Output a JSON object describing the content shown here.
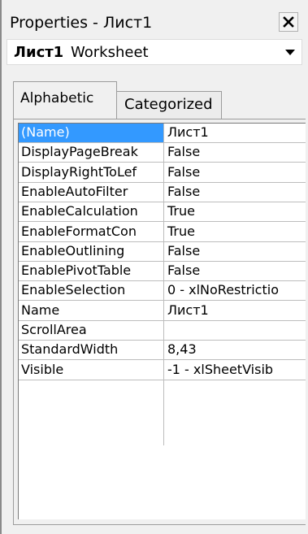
{
  "window": {
    "title": "Properties - Лист1",
    "close_icon": "close-x-icon"
  },
  "object_selector": {
    "name": "Лист1",
    "type": "Worksheet",
    "dropdown_icon": "dropdown-arrow-icon"
  },
  "tabs": [
    {
      "label": "Alphabetic",
      "active": true
    },
    {
      "label": "Categorized",
      "active": false
    }
  ],
  "properties": [
    {
      "name": "(Name)",
      "value": "Лист1",
      "selected": true
    },
    {
      "name": "DisplayPageBreak",
      "value": "False"
    },
    {
      "name": "DisplayRightToLef",
      "value": "False"
    },
    {
      "name": "EnableAutoFilter",
      "value": "False"
    },
    {
      "name": "EnableCalculation",
      "value": "True"
    },
    {
      "name": "EnableFormatCon",
      "value": "True"
    },
    {
      "name": "EnableOutlining",
      "value": "False"
    },
    {
      "name": "EnablePivotTable",
      "value": "False"
    },
    {
      "name": "EnableSelection",
      "value": "0 - xlNoRestrictio"
    },
    {
      "name": "Name",
      "value": "Лист1"
    },
    {
      "name": "ScrollArea",
      "value": ""
    },
    {
      "name": "StandardWidth",
      "value": "8,43"
    },
    {
      "name": "Visible",
      "value": "-1 - xlSheetVisib"
    }
  ],
  "colors": {
    "selection": "#3399ff",
    "background": "#f0f0f0",
    "grid_line": "#bdbdbd"
  }
}
